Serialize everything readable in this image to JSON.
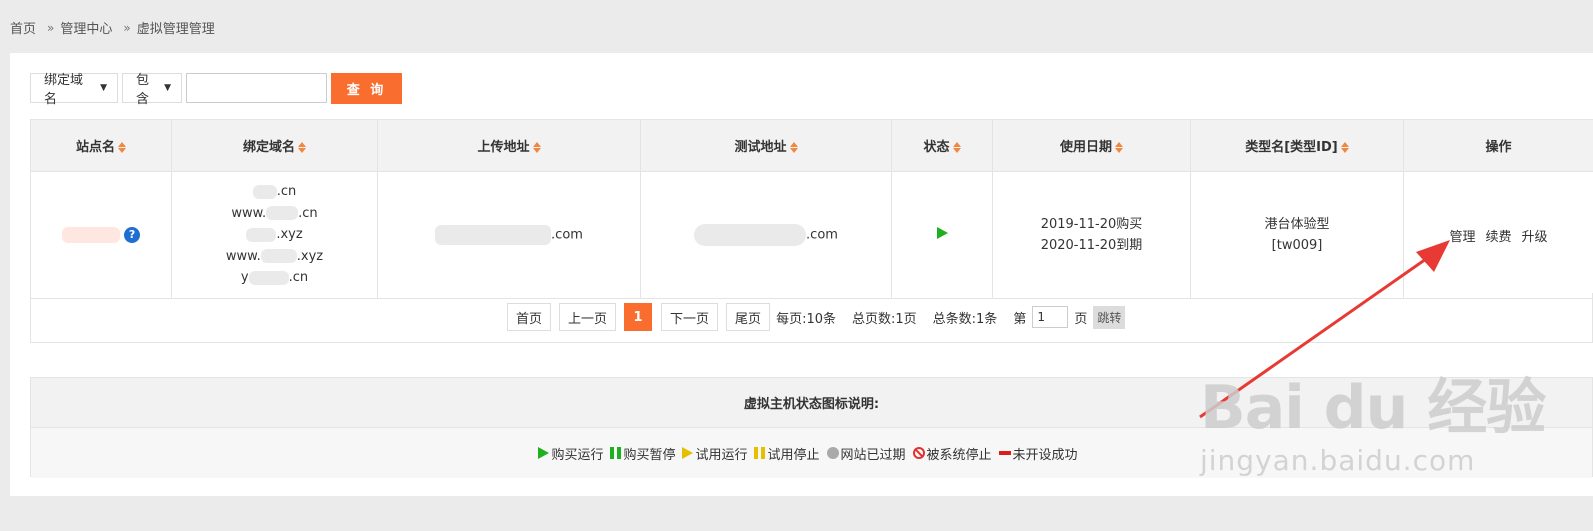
{
  "breadcrumb": {
    "home": "首页",
    "center": "管理中心",
    "current": "虚拟管理管理"
  },
  "search": {
    "field": "绑定域名",
    "op": "包含",
    "button": "查 询"
  },
  "table": {
    "headers": [
      "站点名",
      "绑定域名",
      "上传地址",
      "测试地址",
      "状态",
      "使用日期",
      "类型名[类型ID]",
      "操作"
    ],
    "row": {
      "domains": [
        ".cn",
        "www.",
        ".cn",
        ".xyz",
        "www.",
        ".xyz",
        "y",
        ".cn"
      ],
      "upload_suffix": ".com",
      "test_suffix": ".com",
      "date_buy": "2019-11-20购买",
      "date_expire": "2020-11-20到期",
      "type_name": "港台体验型",
      "type_id": "[tw009]",
      "ops": [
        "管理",
        "续费",
        "升级"
      ]
    }
  },
  "pager": {
    "first": "首页",
    "prev": "上一页",
    "current": "1",
    "next": "下一页",
    "last": "尾页",
    "per_page": "每页:10条",
    "total_pages": "总页数:1页",
    "total_items": "总条数:1条",
    "page_prefix": "第",
    "page_value": "1",
    "page_suffix": "页",
    "jump": "跳转"
  },
  "legend": {
    "title": "虚拟主机状态图标说明:",
    "items": [
      "购买运行",
      "购买暂停",
      "试用运行",
      "试用停止",
      "网站已过期",
      "被系统停止",
      "未开设成功"
    ]
  },
  "watermark": {
    "brand": "Bai du 经验",
    "url": "jingyan.baidu.com"
  },
  "colors": {
    "accent": "#f96d2e",
    "running": "#1eb01e",
    "arrow": "#e83a34"
  }
}
